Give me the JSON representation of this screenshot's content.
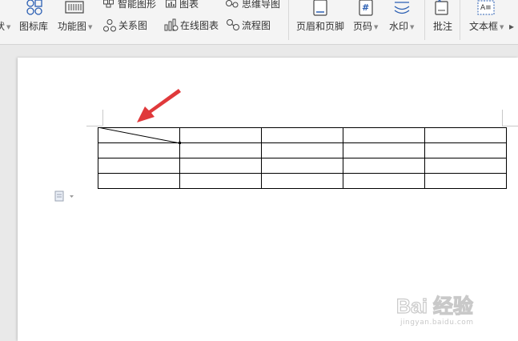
{
  "ribbon": {
    "items": [
      {
        "label": "图标库",
        "icon": "icon-library-icon"
      },
      {
        "label": "功能图",
        "icon": "function-chart-icon"
      },
      {
        "label": "智能图形",
        "icon": "smart-graphic-icon"
      },
      {
        "label": "图表",
        "icon": "chart-icon"
      },
      {
        "label": "思维导图",
        "icon": "mind-map-icon"
      },
      {
        "label": "关系图",
        "icon": "relation-chart-icon"
      },
      {
        "label": "在线图表",
        "icon": "online-chart-icon"
      },
      {
        "label": "流程图",
        "icon": "flowchart-icon"
      },
      {
        "label": "页眉和页脚",
        "icon": "header-footer-icon"
      },
      {
        "label": "页码",
        "icon": "page-number-icon"
      },
      {
        "label": "水印",
        "icon": "watermark-icon"
      },
      {
        "label": "批注",
        "icon": "comment-icon"
      },
      {
        "label": "文本框",
        "icon": "textbox-icon"
      }
    ],
    "partial_left": "状",
    "page_number_glyph": "#",
    "textbox_glyph": "A≡"
  },
  "document": {
    "table": {
      "rows": 4,
      "cols": 5,
      "first_cell_diagonal": true
    }
  },
  "watermark": {
    "brand": "Bai 经验",
    "url": "jingyan.baidu.com"
  },
  "colors": {
    "accent_blue": "#2b5fb3",
    "arrow_red": "#e0393b"
  }
}
